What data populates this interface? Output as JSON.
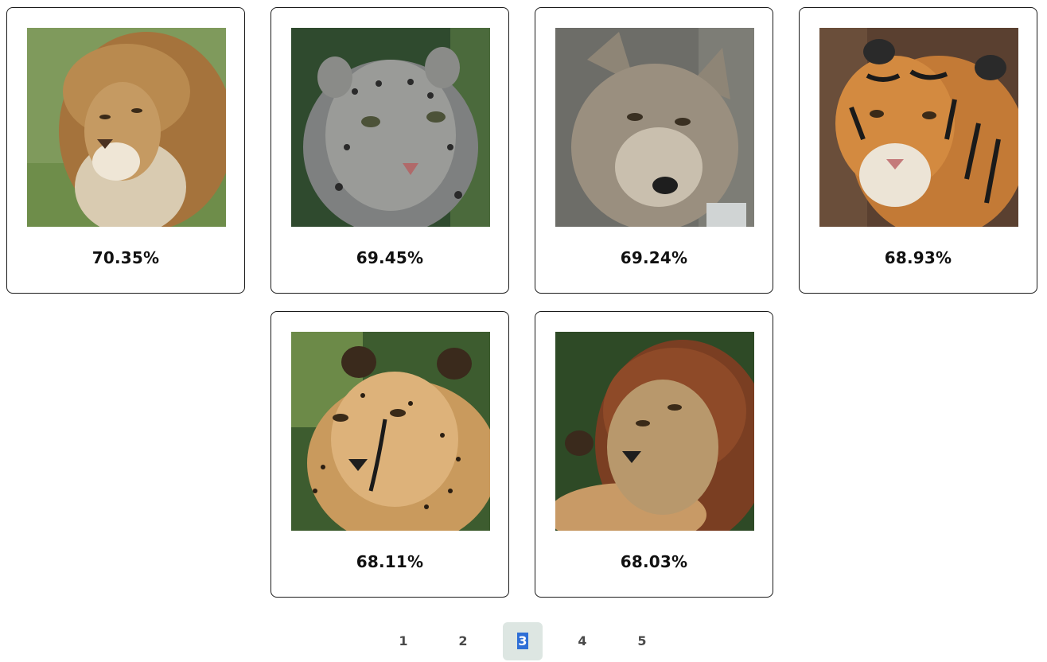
{
  "results": [
    {
      "animal": "lion",
      "score": "70.35%"
    },
    {
      "animal": "snow-leopard",
      "score": "69.45%"
    },
    {
      "animal": "wolf",
      "score": "69.24%"
    },
    {
      "animal": "tiger",
      "score": "68.93%"
    },
    {
      "animal": "cheetah",
      "score": "68.11%"
    },
    {
      "animal": "lion",
      "score": "68.03%"
    }
  ],
  "pagination": {
    "pages": [
      "1",
      "2",
      "3",
      "4",
      "5"
    ],
    "current": "3"
  }
}
